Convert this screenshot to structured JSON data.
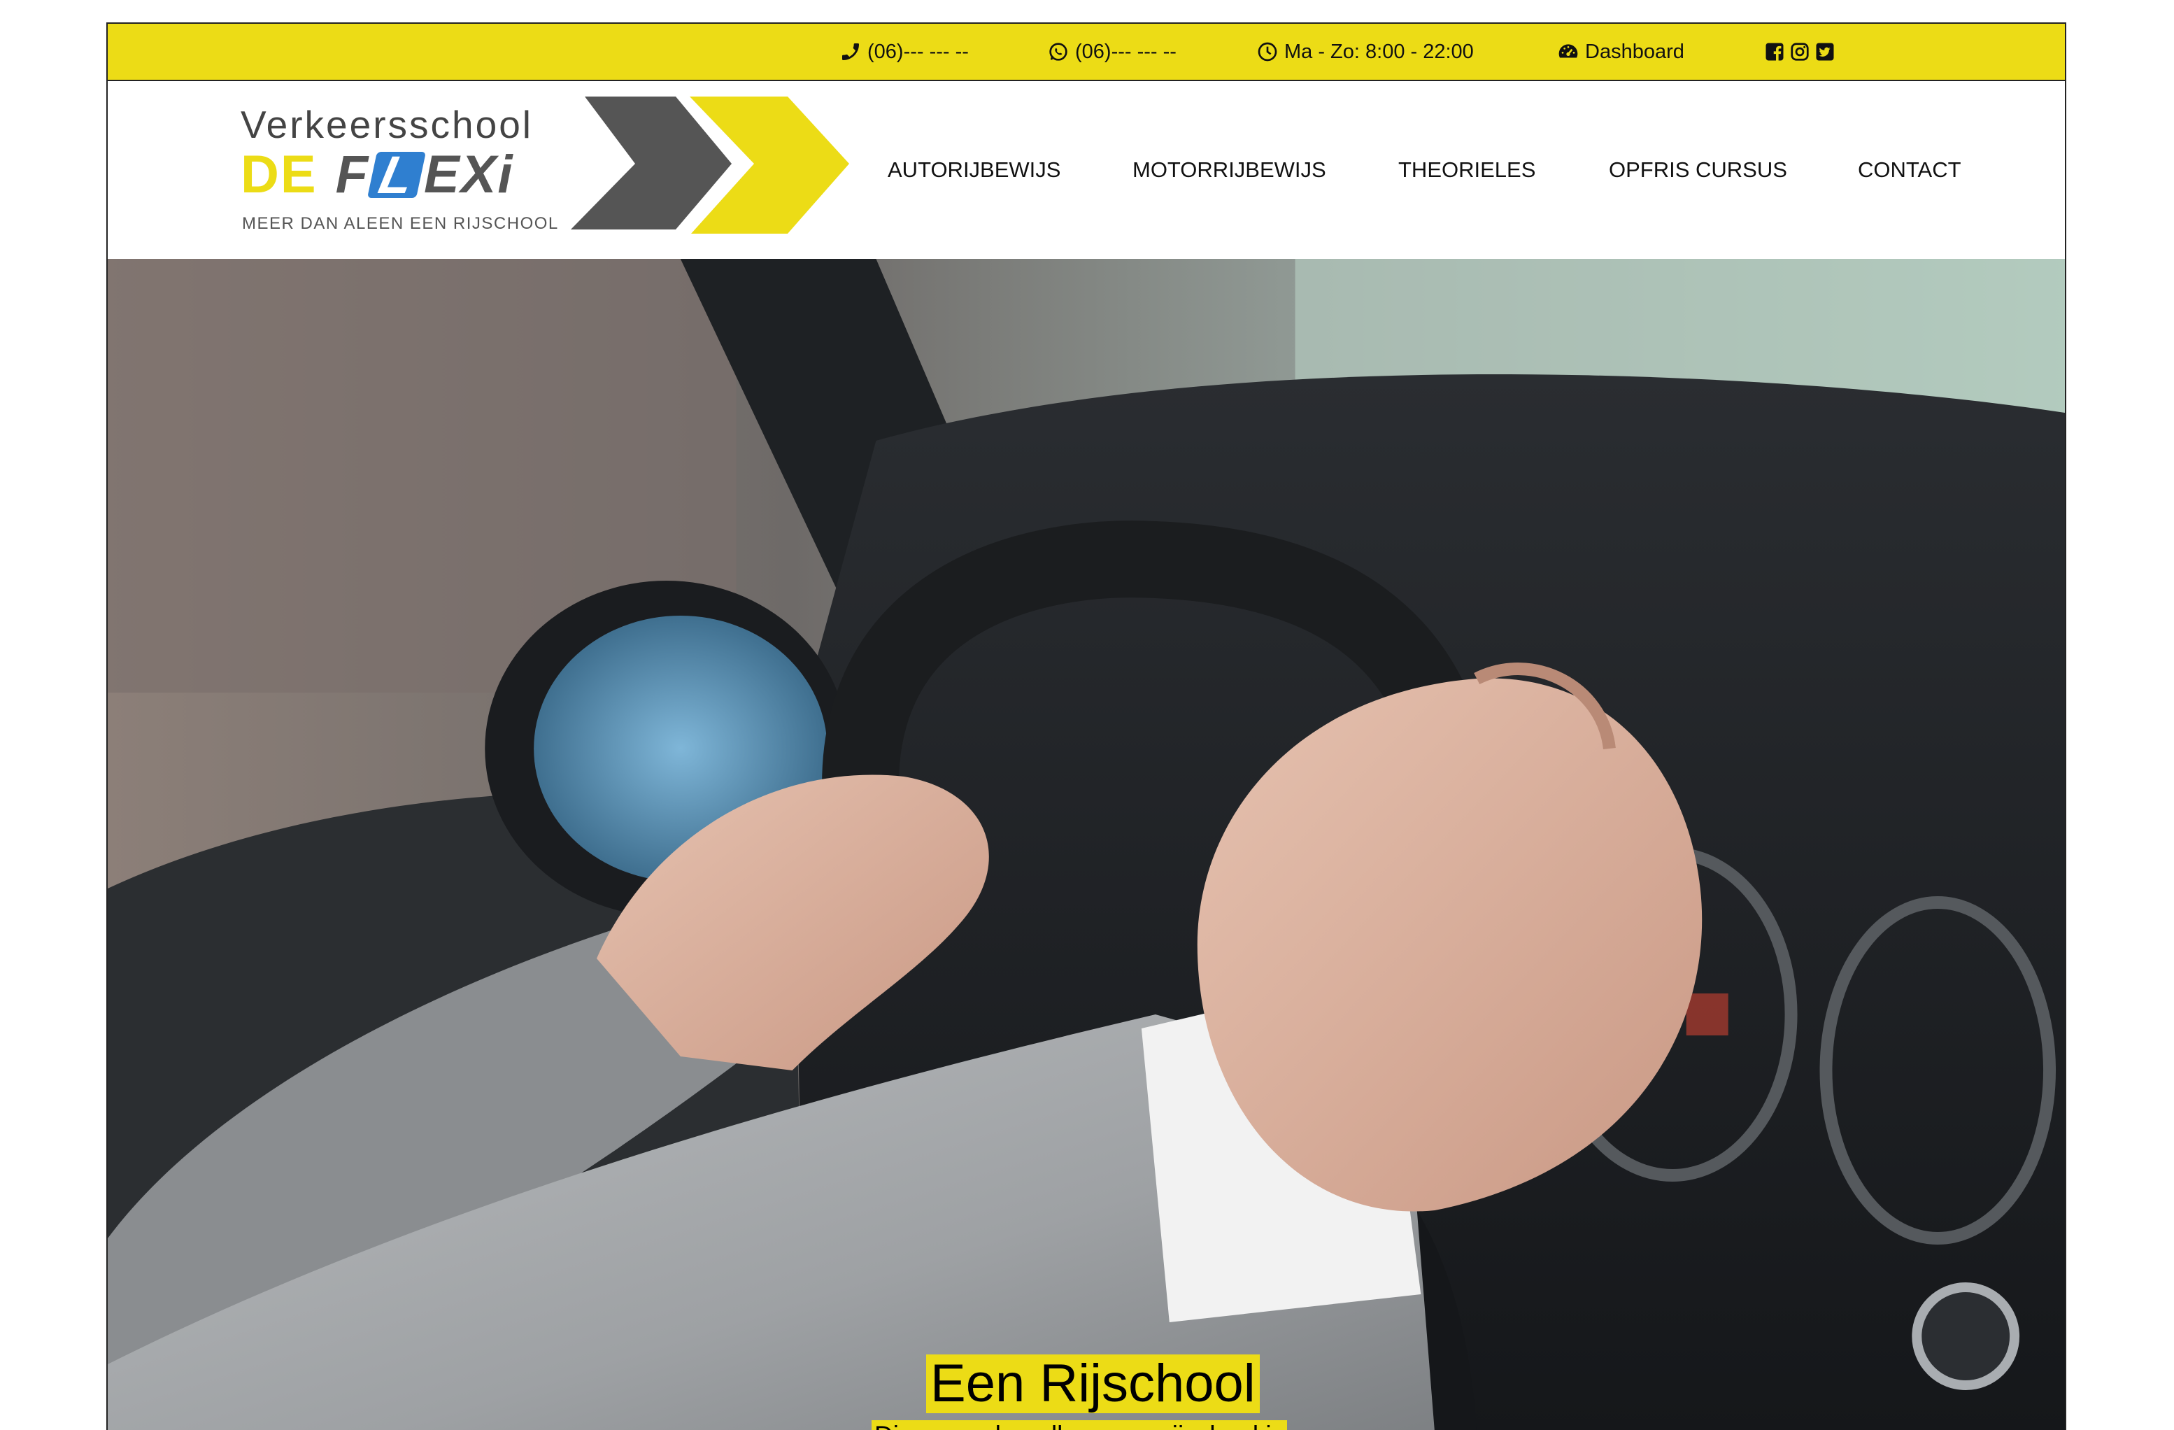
{
  "topbar": {
    "phone": "(06)--- --- --",
    "whatsapp": "(06)--- --- --",
    "hours": "Ma - Zo: 8:00 - 22:00",
    "dashboard": "Dashboard",
    "icons": [
      "phone-icon",
      "whatsapp-icon",
      "clock-icon",
      "dashboard-icon",
      "facebook-icon",
      "instagram-icon",
      "twitter-icon"
    ]
  },
  "logo": {
    "title": "Verkeersschool",
    "brand_de": "DE",
    "brand_f": "F",
    "brand_l": "L",
    "brand_exi": "EXi",
    "tagline": "MEER DAN ALEEN EEN RIJSCHOOL"
  },
  "nav": {
    "items": [
      "AUTORIJBEWIJS",
      "MOTORRIJBEWIJS",
      "THEORIELES",
      "OPFRIS CURSUS",
      "CONTACT"
    ]
  },
  "hero": {
    "title": "Een Rijschool",
    "subtitle": "Die meer dan alleen een rijschool is"
  },
  "colors": {
    "accent": "#ecdc16",
    "logo_grey": "#555555",
    "logo_blue": "#2f7fd0"
  }
}
